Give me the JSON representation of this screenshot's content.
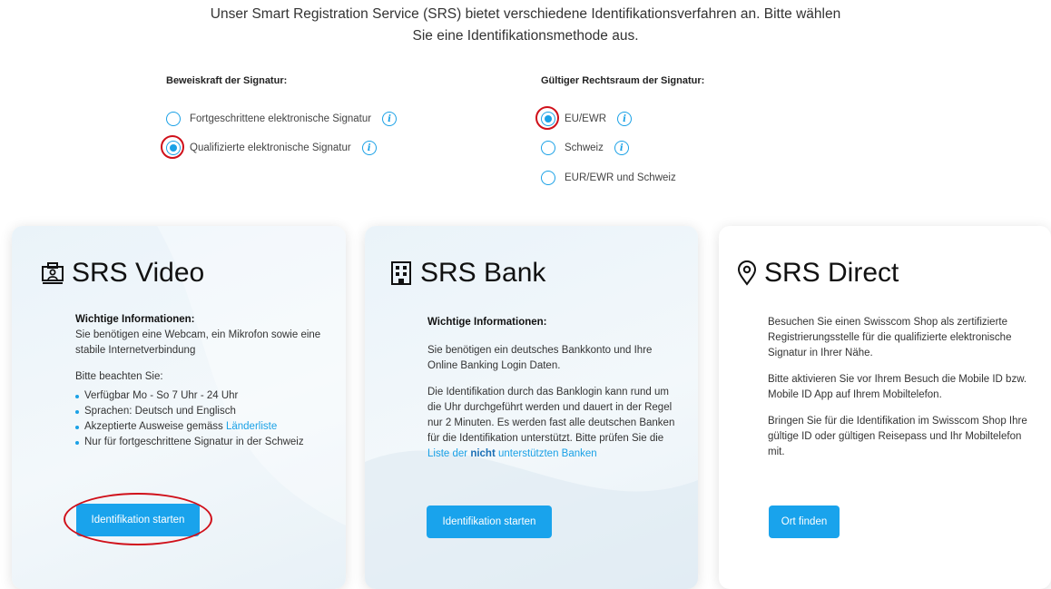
{
  "intro": {
    "line1": "Unser Smart Registration Service (SRS) bietet verschiedene Identifikationsverfahren an. Bitte wählen",
    "line2": "Sie eine Identifikationsmethode aus."
  },
  "signature_strength": {
    "title": "Beweiskraft der Signatur:",
    "options": [
      {
        "label": "Fortgeschrittene elektronische Signatur",
        "selected": false
      },
      {
        "label": "Qualifizierte elektronische Signatur",
        "selected": true
      }
    ]
  },
  "jurisdiction": {
    "title": "Gültiger Rechtsraum der Signatur:",
    "options": [
      {
        "label": "EU/EWR",
        "selected": true
      },
      {
        "label": "Schweiz",
        "selected": false
      },
      {
        "label": "EUR/EWR und Schweiz",
        "selected": false
      }
    ]
  },
  "cards": {
    "video": {
      "title": "SRS Video",
      "info_heading": "Wichtige Informationen:",
      "info_text": "Sie benötigen eine Webcam, ein Mikrofon sowie eine stabile Internetverbindung",
      "note_heading": "Bitte beachten Sie:",
      "bullets": [
        "Verfügbar Mo - So 7 Uhr - 24 Uhr",
        "Sprachen: Deutsch und Englisch",
        "Akzeptierte Ausweise gemäss ",
        "Nur für fortgeschrittene Signatur in der Schweiz"
      ],
      "country_link": "Länderliste",
      "button": "Identifikation starten"
    },
    "bank": {
      "title": "SRS Bank",
      "info_heading": "Wichtige Informationen:",
      "para1": "Sie benötigen ein deutsches Bankkonto und Ihre Online Banking Login Daten.",
      "para2": "Die Identifikation durch das Banklogin kann rund um die Uhr durchgeführt werden und dauert in der Regel nur 2 Minuten. Es werden fast alle deutschen Banken für die Identifikation unterstützt. Bitte prüfen Sie die ",
      "link_part1": "Liste der ",
      "link_bold": "nicht",
      "link_part2": " unterstützten Banken",
      "button": "Identifikation starten"
    },
    "direct": {
      "title": "SRS Direct",
      "para1": "Besuchen Sie einen Swisscom Shop als zertifizierte Registrierungsstelle für die qualifizierte elektronische Signatur in Ihrer Nähe.",
      "para2": "Bitte aktivieren Sie vor Ihrem Besuch die Mobile ID bzw. Mobile ID App auf Ihrem Mobiltelefon.",
      "para3": "Bringen Sie für die Identifikation im Swisscom Shop Ihre gültige ID oder gültigen Reisepass und Ihr Mobiltelefon mit.",
      "button": "Ort finden"
    }
  },
  "colors": {
    "accent": "#19a3ec",
    "highlight": "#d0101a"
  },
  "icons": {
    "video": "video-id-icon",
    "bank": "bank-building-icon",
    "direct": "location-pin-icon",
    "info": "info-icon"
  }
}
